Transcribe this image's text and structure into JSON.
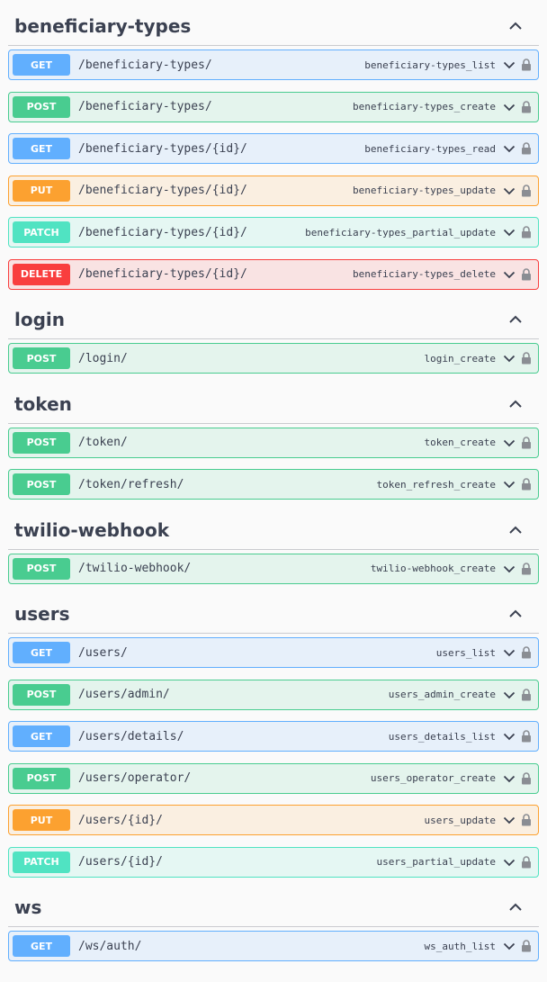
{
  "sections": [
    {
      "title": "beneficiary-types",
      "ops": [
        {
          "method": "GET",
          "path": "/beneficiary-types/",
          "op_id": "beneficiary-types_list"
        },
        {
          "method": "POST",
          "path": "/beneficiary-types/",
          "op_id": "beneficiary-types_create"
        },
        {
          "method": "GET",
          "path": "/beneficiary-types/{id}/",
          "op_id": "beneficiary-types_read"
        },
        {
          "method": "PUT",
          "path": "/beneficiary-types/{id}/",
          "op_id": "beneficiary-types_update"
        },
        {
          "method": "PATCH",
          "path": "/beneficiary-types/{id}/",
          "op_id": "beneficiary-types_partial_update"
        },
        {
          "method": "DELETE",
          "path": "/beneficiary-types/{id}/",
          "op_id": "beneficiary-types_delete"
        }
      ]
    },
    {
      "title": "login",
      "ops": [
        {
          "method": "POST",
          "path": "/login/",
          "op_id": "login_create"
        }
      ]
    },
    {
      "title": "token",
      "ops": [
        {
          "method": "POST",
          "path": "/token/",
          "op_id": "token_create"
        },
        {
          "method": "POST",
          "path": "/token/refresh/",
          "op_id": "token_refresh_create"
        }
      ]
    },
    {
      "title": "twilio-webhook",
      "ops": [
        {
          "method": "POST",
          "path": "/twilio-webhook/",
          "op_id": "twilio-webhook_create"
        }
      ]
    },
    {
      "title": "users",
      "ops": [
        {
          "method": "GET",
          "path": "/users/",
          "op_id": "users_list"
        },
        {
          "method": "POST",
          "path": "/users/admin/",
          "op_id": "users_admin_create"
        },
        {
          "method": "GET",
          "path": "/users/details/",
          "op_id": "users_details_list"
        },
        {
          "method": "POST",
          "path": "/users/operator/",
          "op_id": "users_operator_create"
        },
        {
          "method": "PUT",
          "path": "/users/{id}/",
          "op_id": "users_update"
        },
        {
          "method": "PATCH",
          "path": "/users/{id}/",
          "op_id": "users_partial_update"
        }
      ]
    },
    {
      "title": "ws",
      "ops": [
        {
          "method": "GET",
          "path": "/ws/auth/",
          "op_id": "ws_auth_list"
        }
      ]
    }
  ],
  "colors": {
    "get": "#61affe",
    "post": "#49cc90",
    "put": "#fca130",
    "patch": "#50e3c2",
    "delete": "#f93e3e"
  }
}
